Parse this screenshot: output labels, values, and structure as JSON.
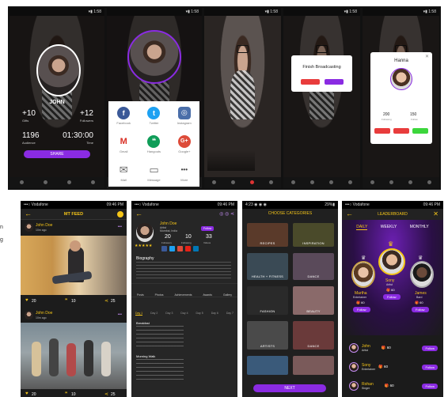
{
  "colors": {
    "accent": "#8a2be2",
    "gold": "#f5c518",
    "dark": "#1b1b1b"
  },
  "top": {
    "screen1": {
      "name": "JOHN",
      "gifts_value": "+10",
      "gifts_label": "Gifts",
      "followers_value": "+12",
      "followers_label": "Followers",
      "audience_value": "1196",
      "audience_label": "Audience",
      "time_value": "01:30:00",
      "time_label": "Time",
      "share_label": "SHARE"
    },
    "screen2": {
      "share_items": [
        {
          "label": "Facebook",
          "icon": "facebook-icon",
          "glyph": "f",
          "color": "#3b5998"
        },
        {
          "label": "Twitter",
          "icon": "twitter-icon",
          "glyph": "t",
          "color": "#1da1f2"
        },
        {
          "label": "Instagram",
          "icon": "instagram-icon",
          "glyph": "◎",
          "color": "#4a6ea9"
        },
        {
          "label": "Gmail",
          "icon": "gmail-icon",
          "glyph": "M",
          "color": "#ffffff"
        },
        {
          "label": "Hangouts",
          "icon": "hangouts-icon",
          "glyph": "❝",
          "color": "#0f9d58"
        },
        {
          "label": "Google+",
          "icon": "google-plus-icon",
          "glyph": "G+",
          "color": "#dd4b39"
        },
        {
          "label": "Mail",
          "icon": "mail-icon",
          "glyph": "✉",
          "color": "#666666"
        },
        {
          "label": "Message",
          "icon": "message-icon",
          "glyph": "▭",
          "color": "#666666"
        },
        {
          "label": "More",
          "icon": "more-icon",
          "glyph": "•••",
          "color": "#666666"
        }
      ]
    },
    "screen4": {
      "dialog_title": "Finish Broadcasting"
    },
    "screen5": {
      "dialog_name": "Hanna",
      "stat1_value": "200",
      "stat1_label": "Following",
      "stat2_value": "150",
      "stat2_label": "Follow"
    }
  },
  "feed": {
    "title": "MT FEED",
    "posts": [
      {
        "author": "John Doe",
        "time": "10m ago",
        "likes": "20",
        "comments": "10",
        "shares": "25"
      },
      {
        "author": "John Doe",
        "time": "10m ago",
        "likes": "20",
        "comments": "10",
        "shares": "25"
      }
    ]
  },
  "profile": {
    "name": "John Doe",
    "line1": "Artist",
    "line2": "Mumbai, India",
    "badge": "Follow",
    "stats": [
      {
        "value": "20",
        "label": "Followers"
      },
      {
        "value": "10",
        "label": "Following"
      },
      {
        "value": "33",
        "label": "Videos"
      }
    ],
    "section_title": "Biography",
    "menu": [
      "Posts",
      "Photos",
      "Achievements",
      "Awards",
      "Gallery"
    ],
    "days": [
      "Day 1",
      "Day 2",
      "Day 3",
      "Day 4",
      "Day 5",
      "Day 6",
      "Day 7"
    ],
    "items": [
      "Breakfast",
      "Morning Walk"
    ]
  },
  "categories": {
    "title": "CHOOSE CATEGORIES",
    "tiles": [
      {
        "label": "RECIPES",
        "color": "#5a3a2a"
      },
      {
        "label": "INSPIRATION",
        "color": "#4a4a2a"
      },
      {
        "label": "HEALTH + FITNESS",
        "color": "#3a4a55"
      },
      {
        "label": "DANCE",
        "color": "#5a4a5a"
      },
      {
        "label": "FASHION",
        "color": "#2a2a2a"
      },
      {
        "label": "BEAUTY",
        "color": "#8a6a6a"
      },
      {
        "label": "ARTISTS",
        "color": "#4a4a4a"
      },
      {
        "label": "DANCE",
        "color": "#6a3a3a"
      },
      {
        "label": "",
        "color": "#3a5a7a"
      },
      {
        "label": "",
        "color": "#7a5a5a"
      }
    ],
    "next_label": "NEXT"
  },
  "leaderboard": {
    "title": "LEADERBOARD",
    "tabs": [
      "DAILY",
      "WEEKLY",
      "MONTHLY"
    ],
    "podium": [
      {
        "name": "Martha",
        "role": "Entertainer",
        "score": "60"
      },
      {
        "name": "Sony",
        "role": "Artist",
        "score": "60"
      },
      {
        "name": "James",
        "role": "Bard",
        "score": "60"
      }
    ],
    "rows": [
      {
        "name": "John",
        "role": "Artist",
        "score": "60"
      },
      {
        "name": "Sony",
        "role": "Entertainer",
        "score": "60"
      },
      {
        "name": "Rohan",
        "role": "Singer",
        "score": "60"
      }
    ],
    "follow_label": "Follow"
  }
}
